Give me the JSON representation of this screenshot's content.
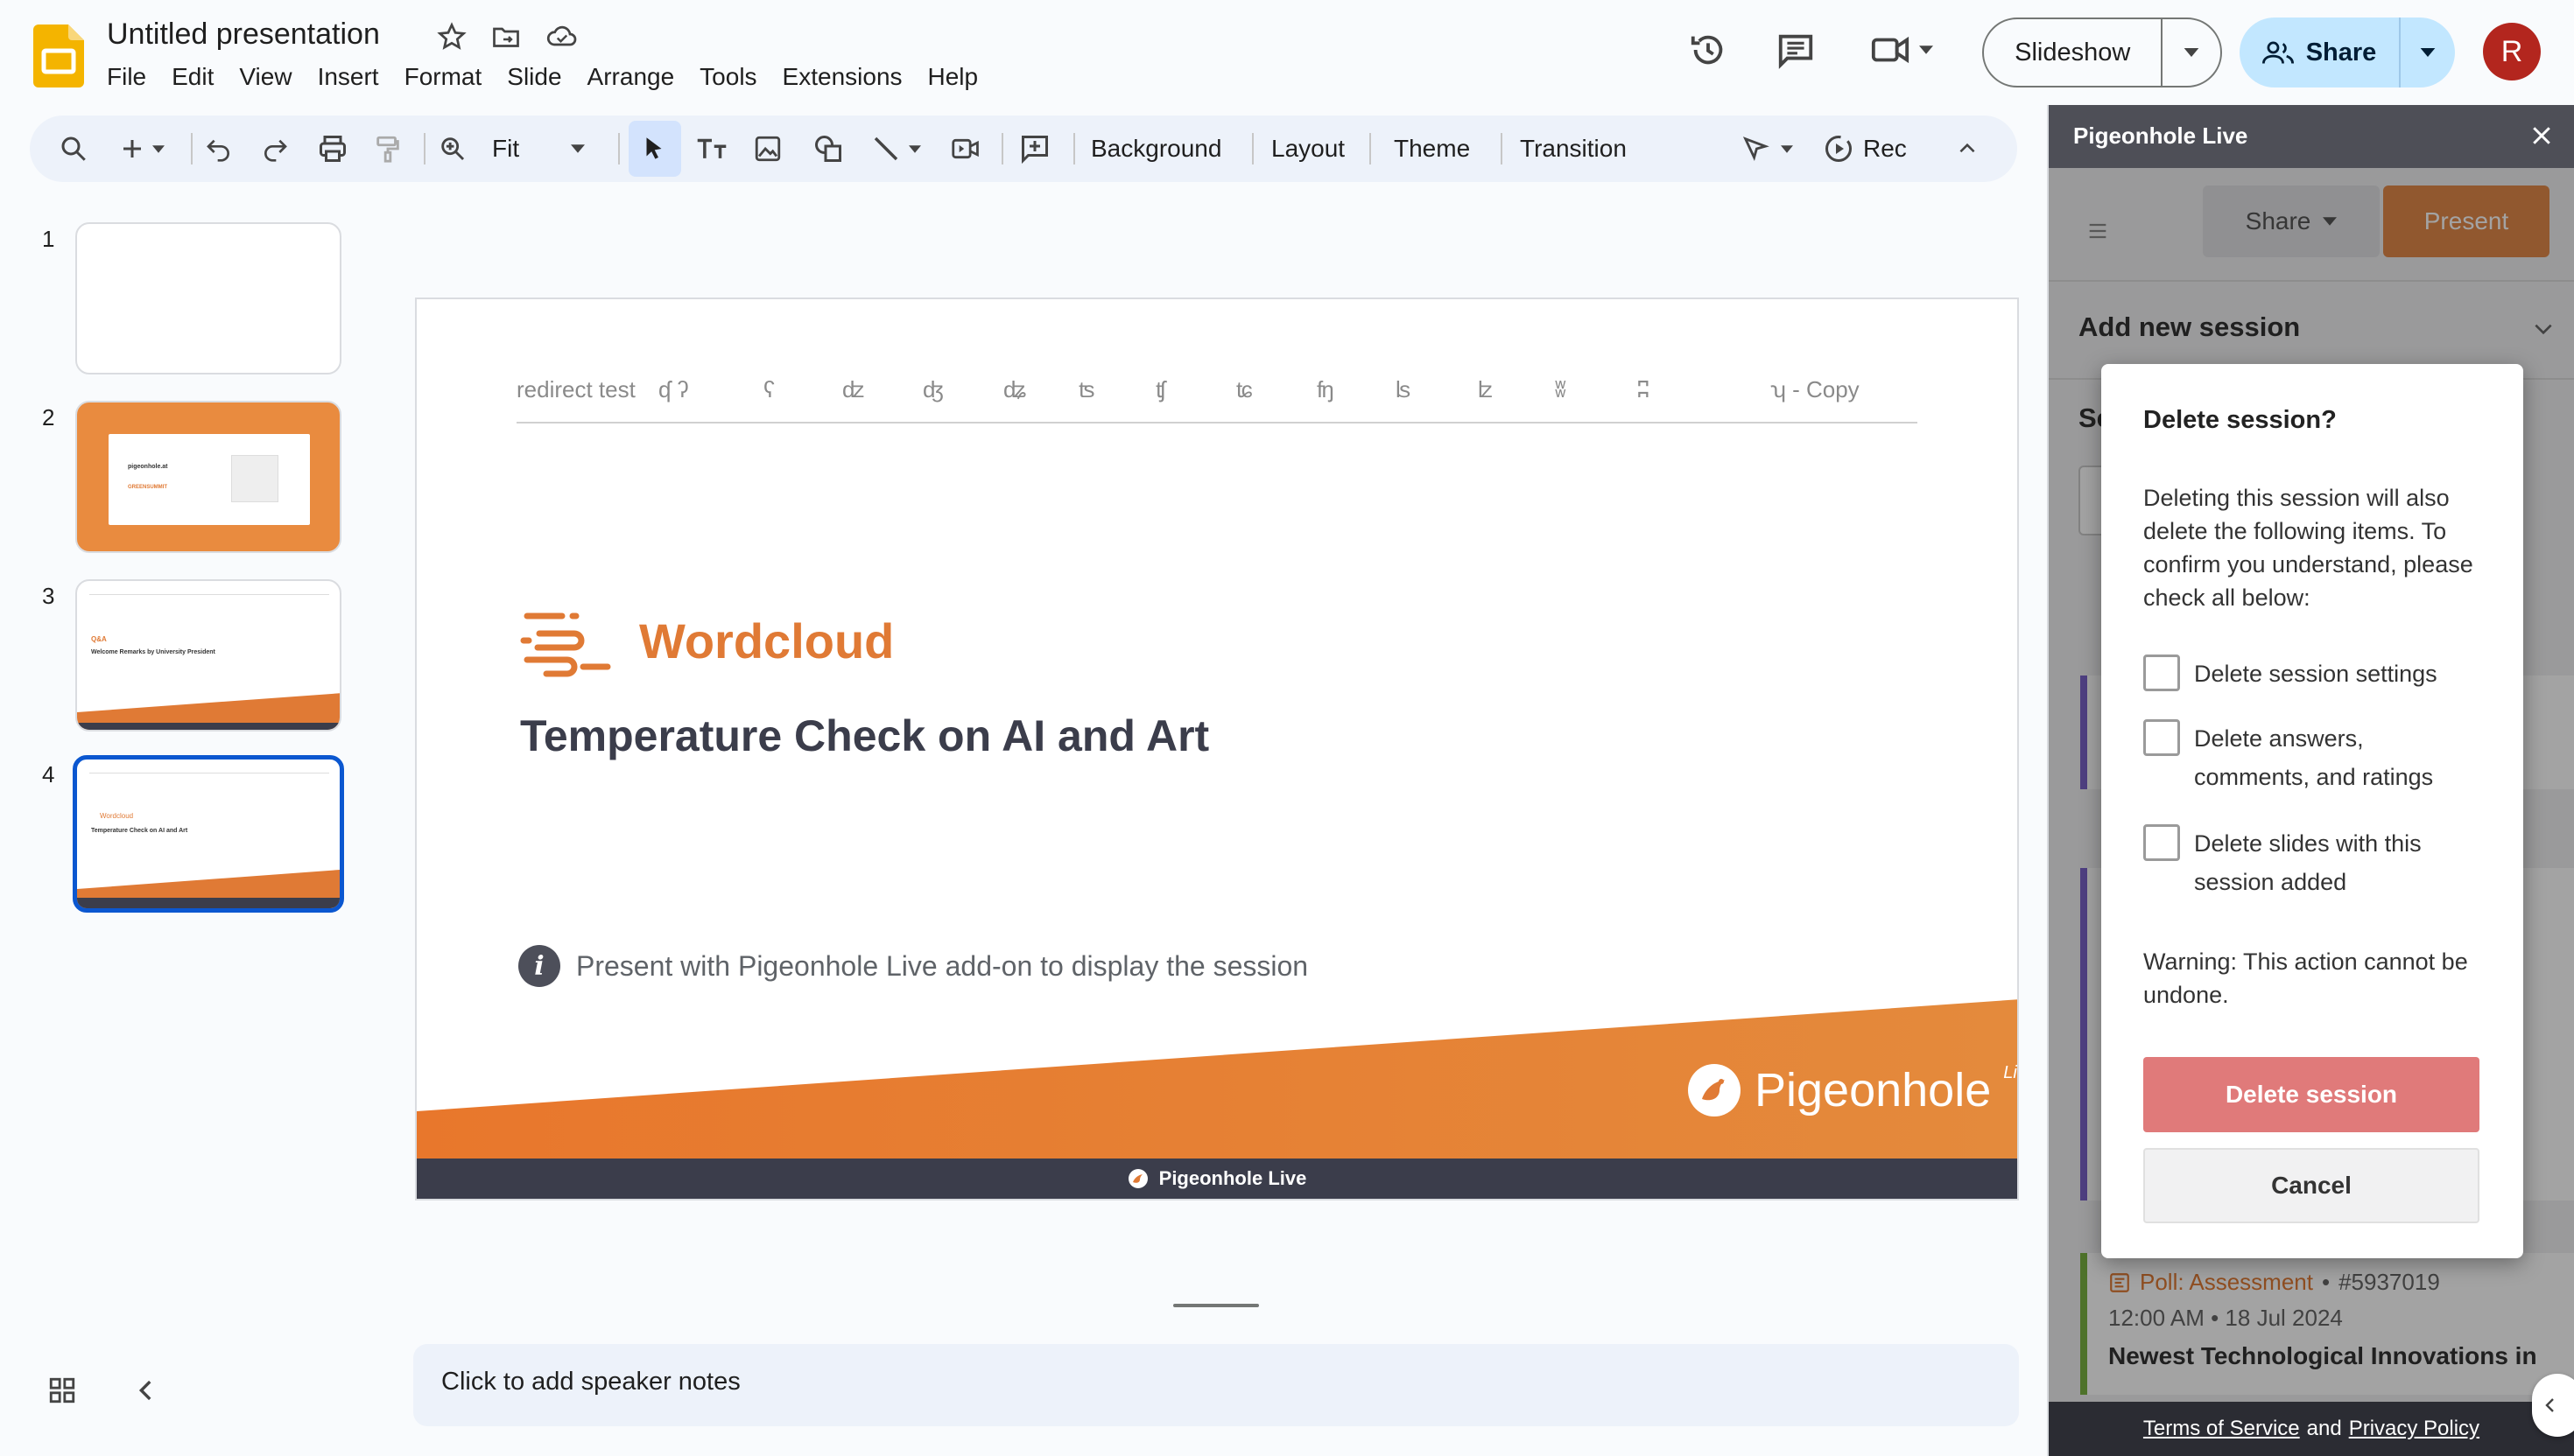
{
  "app": {
    "title": "Untitled presentation",
    "menu": [
      "File",
      "Edit",
      "View",
      "Insert",
      "Format",
      "Slide",
      "Arrange",
      "Tools",
      "Extensions",
      "Help"
    ],
    "slideshow_label": "Slideshow",
    "share_label": "Share",
    "avatar_initial": "R",
    "brand_color": "#f4b400"
  },
  "toolbar": {
    "zoom": "Fit",
    "background": "Background",
    "layout": "Layout",
    "theme": "Theme",
    "transition": "Transition",
    "rec": "Rec"
  },
  "filmstrip": {
    "slides": [
      {
        "number": "1"
      },
      {
        "number": "2",
        "url_text": "pigeonhole.at",
        "code": "GREENSUMMIT"
      },
      {
        "number": "3",
        "label": "Q&A",
        "title": "Welcome Remarks by University President"
      },
      {
        "number": "4",
        "label": "Wordcloud",
        "title": "Temperature Check on AI and Art",
        "active": true
      }
    ]
  },
  "slide": {
    "symbols": [
      "redirect test",
      "ʠ ʔ",
      "ʕ",
      "ʣ",
      "ʤ",
      "ʥ",
      "ʦ",
      "ʧ",
      "ʨ",
      "ʩ",
      "ʪ",
      "ʫ",
      "ʬ",
      "ʭ",
      "ʮ",
      "ʮ - Copy"
    ],
    "session_type": "Wordcloud",
    "session_title": "Temperature Check on AI and Art",
    "present_note": "Present with Pigeonhole Live add-on to display the session",
    "logo_text": "Pigeonhole",
    "logo_live": "Live",
    "footer": "Pigeonhole Live",
    "accent": "#e07a35"
  },
  "notes": {
    "placeholder": "Click to add speaker notes"
  },
  "panel": {
    "title": "Pigeonhole Live",
    "share": "Share",
    "present": "Present",
    "add_session": "Add new session",
    "poll_type": "Poll: Assessment",
    "poll_id": "#5937019",
    "poll_time": "12:00 AM",
    "poll_date": "18 Jul 2024",
    "poll_title": "Newest Technological Innovations in",
    "footer_terms": "Terms of Service",
    "footer_and": "and",
    "footer_privacy": "Privacy Policy"
  },
  "dialog": {
    "title": "Delete session?",
    "body": "Deleting this session will also delete the following items. To confirm you understand, please check all below:",
    "options": [
      "Delete session settings",
      "Delete answers, comments, and ratings",
      "Delete slides with this session added"
    ],
    "warning": "Warning: This action cannot be undone.",
    "delete_label": "Delete session",
    "cancel_label": "Cancel"
  }
}
